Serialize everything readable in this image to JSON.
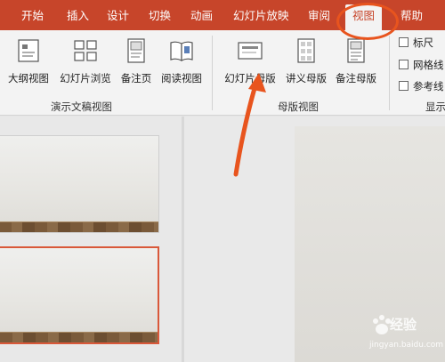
{
  "tabs": [
    "开始",
    "插入",
    "设计",
    "切换",
    "动画",
    "幻灯片放映",
    "审阅",
    "视图",
    "帮助"
  ],
  "active_tab": "视图",
  "ribbon": {
    "presentation_views": {
      "buttons": [
        "大纲视图",
        "幻灯片浏览",
        "备注页",
        "阅读视图"
      ],
      "label": "演示文稿视图"
    },
    "master_views": {
      "buttons": [
        "幻灯片母版",
        "讲义母版",
        "备注母版"
      ],
      "label": "母版视图"
    },
    "show": {
      "checkboxes": [
        "标尺",
        "网格线",
        "参考线"
      ],
      "checked": [
        false,
        false,
        false
      ],
      "label": "显示"
    }
  },
  "watermark": {
    "text": "经验",
    "url": "jingyan.baidu.com"
  },
  "colors": {
    "tab_bar": "#c7452a",
    "ribbon_bg": "#f3f3f3",
    "annotation": "#e8541e",
    "selected_slide_border": "#d9583a"
  }
}
